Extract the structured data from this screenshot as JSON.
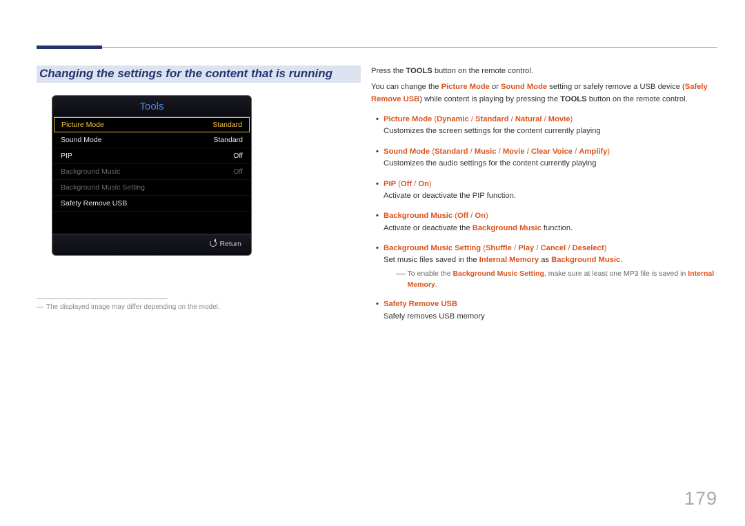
{
  "section_title": "Changing the settings for the content that is running",
  "tv": {
    "title": "Tools",
    "rows": [
      {
        "label": "Picture Mode",
        "value": "Standard",
        "state": "sel"
      },
      {
        "label": "Sound Mode",
        "value": "Standard",
        "state": ""
      },
      {
        "label": "PIP",
        "value": "Off",
        "state": ""
      },
      {
        "label": "Background Music",
        "value": "Off",
        "state": "dim"
      },
      {
        "label": "Background Music Setting",
        "value": "",
        "state": "dim"
      },
      {
        "label": "Safety Remove USB",
        "value": "",
        "state": ""
      }
    ],
    "return": "Return"
  },
  "footnote": "The displayed image may differ depending on the model.",
  "intro": {
    "l1a": "Press the ",
    "l1b": "TOOLS",
    "l1c": " button on the remote control.",
    "l2a": "You can change the ",
    "l2b": "Picture Mode",
    "l2c": " or ",
    "l2d": "Sound Mode",
    "l2e": " setting or safely remove a USB device (",
    "l2f": "Safely Remove USB",
    "l2g": ") while content is playing by pressing the ",
    "l2h": "TOOLS",
    "l2i": " button on the remote control."
  },
  "b1": {
    "t1": "Picture Mode",
    "t2": " (",
    "t3": "Dynamic",
    "t4": " / ",
    "t5": "Standard",
    "t6": " / ",
    "t7": "Natural",
    "t8": " / ",
    "t9": "Movie",
    "t10": ")",
    "desc": "Customizes the screen settings for the content currently playing"
  },
  "b2": {
    "t1": "Sound Mode",
    "t2": " (",
    "t3": "Standard",
    "t4": " / ",
    "t5": "Music",
    "t6": " / ",
    "t7": "Movie",
    "t8": " / ",
    "t9": "Clear Voice",
    "t10": " / ",
    "t11": "Amplify",
    "t12": ")",
    "desc": "Customizes the audio settings for the content currently playing"
  },
  "b3": {
    "t1": "PIP",
    "t2": " (",
    "t3": "Off",
    "t4": " / ",
    "t5": "On",
    "t6": ")",
    "desc": "Activate or deactivate the PIP function."
  },
  "b4": {
    "t1": "Background Music",
    "t2": " (",
    "t3": "Off",
    "t4": " / ",
    "t5": "On",
    "t6": ")",
    "d1": "Activate or deactivate the ",
    "d2": "Background Music",
    "d3": " function."
  },
  "b5": {
    "t1": "Background Music Setting",
    "t2": " (",
    "t3": "Shuffle",
    "t4": " / ",
    "t5": "Play",
    "t6": " / ",
    "t7": "Cancel",
    "t8": " / ",
    "t9": "Deselect",
    "t10": ")",
    "d1": "Set music files saved in the ",
    "d2": "Internal Memory",
    "d3": " as ",
    "d4": "Background Music",
    "d5": ".",
    "n1": "To enable the ",
    "n2": "Background Music Setting",
    "n3": ", make sure at least one MP3 file is saved in ",
    "n4": "Internal Memory",
    "n5": "."
  },
  "b6": {
    "t1": "Safety Remove USB",
    "desc": "Safely removes USB memory"
  },
  "page": "179"
}
